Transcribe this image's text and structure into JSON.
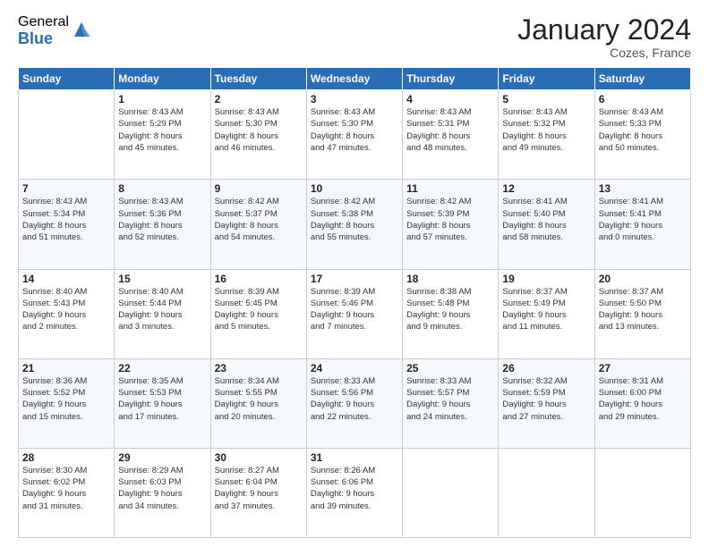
{
  "header": {
    "logo_general": "General",
    "logo_blue": "Blue",
    "month_title": "January 2024",
    "location": "Cozes, France"
  },
  "columns": [
    "Sunday",
    "Monday",
    "Tuesday",
    "Wednesday",
    "Thursday",
    "Friday",
    "Saturday"
  ],
  "weeks": [
    [
      {
        "day": "",
        "info": ""
      },
      {
        "day": "1",
        "info": "Sunrise: 8:43 AM\nSunset: 5:29 PM\nDaylight: 8 hours\nand 45 minutes."
      },
      {
        "day": "2",
        "info": "Sunrise: 8:43 AM\nSunset: 5:30 PM\nDaylight: 8 hours\nand 46 minutes."
      },
      {
        "day": "3",
        "info": "Sunrise: 8:43 AM\nSunset: 5:30 PM\nDaylight: 8 hours\nand 47 minutes."
      },
      {
        "day": "4",
        "info": "Sunrise: 8:43 AM\nSunset: 5:31 PM\nDaylight: 8 hours\nand 48 minutes."
      },
      {
        "day": "5",
        "info": "Sunrise: 8:43 AM\nSunset: 5:32 PM\nDaylight: 8 hours\nand 49 minutes."
      },
      {
        "day": "6",
        "info": "Sunrise: 8:43 AM\nSunset: 5:33 PM\nDaylight: 8 hours\nand 50 minutes."
      }
    ],
    [
      {
        "day": "7",
        "info": "Sunrise: 8:43 AM\nSunset: 5:34 PM\nDaylight: 8 hours\nand 51 minutes."
      },
      {
        "day": "8",
        "info": "Sunrise: 8:43 AM\nSunset: 5:36 PM\nDaylight: 8 hours\nand 52 minutes."
      },
      {
        "day": "9",
        "info": "Sunrise: 8:42 AM\nSunset: 5:37 PM\nDaylight: 8 hours\nand 54 minutes."
      },
      {
        "day": "10",
        "info": "Sunrise: 8:42 AM\nSunset: 5:38 PM\nDaylight: 8 hours\nand 55 minutes."
      },
      {
        "day": "11",
        "info": "Sunrise: 8:42 AM\nSunset: 5:39 PM\nDaylight: 8 hours\nand 57 minutes."
      },
      {
        "day": "12",
        "info": "Sunrise: 8:41 AM\nSunset: 5:40 PM\nDaylight: 8 hours\nand 58 minutes."
      },
      {
        "day": "13",
        "info": "Sunrise: 8:41 AM\nSunset: 5:41 PM\nDaylight: 9 hours\nand 0 minutes."
      }
    ],
    [
      {
        "day": "14",
        "info": "Sunrise: 8:40 AM\nSunset: 5:43 PM\nDaylight: 9 hours\nand 2 minutes."
      },
      {
        "day": "15",
        "info": "Sunrise: 8:40 AM\nSunset: 5:44 PM\nDaylight: 9 hours\nand 3 minutes."
      },
      {
        "day": "16",
        "info": "Sunrise: 8:39 AM\nSunset: 5:45 PM\nDaylight: 9 hours\nand 5 minutes."
      },
      {
        "day": "17",
        "info": "Sunrise: 8:39 AM\nSunset: 5:46 PM\nDaylight: 9 hours\nand 7 minutes."
      },
      {
        "day": "18",
        "info": "Sunrise: 8:38 AM\nSunset: 5:48 PM\nDaylight: 9 hours\nand 9 minutes."
      },
      {
        "day": "19",
        "info": "Sunrise: 8:37 AM\nSunset: 5:49 PM\nDaylight: 9 hours\nand 11 minutes."
      },
      {
        "day": "20",
        "info": "Sunrise: 8:37 AM\nSunset: 5:50 PM\nDaylight: 9 hours\nand 13 minutes."
      }
    ],
    [
      {
        "day": "21",
        "info": "Sunrise: 8:36 AM\nSunset: 5:52 PM\nDaylight: 9 hours\nand 15 minutes."
      },
      {
        "day": "22",
        "info": "Sunrise: 8:35 AM\nSunset: 5:53 PM\nDaylight: 9 hours\nand 17 minutes."
      },
      {
        "day": "23",
        "info": "Sunrise: 8:34 AM\nSunset: 5:55 PM\nDaylight: 9 hours\nand 20 minutes."
      },
      {
        "day": "24",
        "info": "Sunrise: 8:33 AM\nSunset: 5:56 PM\nDaylight: 9 hours\nand 22 minutes."
      },
      {
        "day": "25",
        "info": "Sunrise: 8:33 AM\nSunset: 5:57 PM\nDaylight: 9 hours\nand 24 minutes."
      },
      {
        "day": "26",
        "info": "Sunrise: 8:32 AM\nSunset: 5:59 PM\nDaylight: 9 hours\nand 27 minutes."
      },
      {
        "day": "27",
        "info": "Sunrise: 8:31 AM\nSunset: 6:00 PM\nDaylight: 9 hours\nand 29 minutes."
      }
    ],
    [
      {
        "day": "28",
        "info": "Sunrise: 8:30 AM\nSunset: 6:02 PM\nDaylight: 9 hours\nand 31 minutes."
      },
      {
        "day": "29",
        "info": "Sunrise: 8:29 AM\nSunset: 6:03 PM\nDaylight: 9 hours\nand 34 minutes."
      },
      {
        "day": "30",
        "info": "Sunrise: 8:27 AM\nSunset: 6:04 PM\nDaylight: 9 hours\nand 37 minutes."
      },
      {
        "day": "31",
        "info": "Sunrise: 8:26 AM\nSunset: 6:06 PM\nDaylight: 9 hours\nand 39 minutes."
      },
      {
        "day": "",
        "info": ""
      },
      {
        "day": "",
        "info": ""
      },
      {
        "day": "",
        "info": ""
      }
    ]
  ]
}
